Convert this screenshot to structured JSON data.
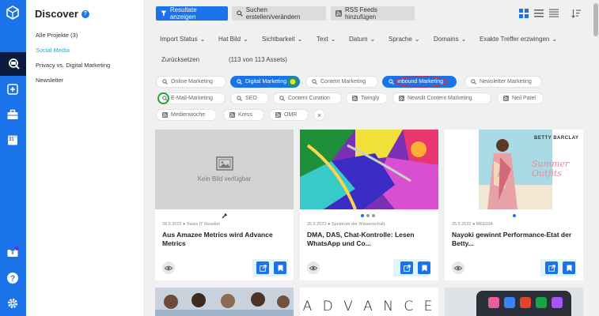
{
  "rail": {
    "icons": [
      "logo-cube-icon",
      "discover-icon",
      "add-icon",
      "briefcase-icon",
      "calendar-icon",
      "upload-icon",
      "help-icon",
      "settings-icon"
    ],
    "calendar_day": "31"
  },
  "sidebar": {
    "title": "Discover",
    "help_label": "?",
    "items": [
      {
        "label": "Alle Projekte (3)"
      },
      {
        "label": "Social Media"
      },
      {
        "label": "Privacy vs. Digital Marketing"
      },
      {
        "label": "Newsletter"
      }
    ]
  },
  "toolbar": {
    "show_results": "Resultate anzeigen",
    "search_create": "Suchen erstellen/verändern",
    "rss_add": "RSS Feeds hinzufügen"
  },
  "filters": {
    "items": [
      "Import Status",
      "Hat Bild",
      "Sichtbarkeit",
      "Text",
      "Datum",
      "Sprache",
      "Domains",
      "Exakte Treffer erzwingen"
    ],
    "reset": "Zurücksetzen",
    "count": "(113 von 113 Assets)"
  },
  "chips": [
    {
      "label": "Online Marketing",
      "icon": "search",
      "active": false
    },
    {
      "label": "Digital Marketing",
      "icon": "search",
      "active": true
    },
    {
      "label": "Content Marketing",
      "icon": "search",
      "active": false
    },
    {
      "label": "Inbound Marketing",
      "icon": "search",
      "active": true
    },
    {
      "label": "Newsletter Marketing",
      "icon": "search",
      "active": false
    },
    {
      "label": "E-Mail-Marketing",
      "icon": "search",
      "active": false
    },
    {
      "label": "SEO",
      "icon": "search",
      "active": false
    },
    {
      "label": "Content Curation",
      "icon": "search",
      "active": false
    },
    {
      "label": "Twingly",
      "icon": "rss",
      "active": false
    },
    {
      "label": "Newslit Content Marketing",
      "icon": "rss",
      "active": false
    },
    {
      "label": "Neil Patel",
      "icon": "rss",
      "active": false
    },
    {
      "label": "Medienwoche",
      "icon": "rss",
      "active": false
    },
    {
      "label": "Kress",
      "icon": "rss",
      "active": false
    },
    {
      "label": "OMR",
      "icon": "rss",
      "active": false
    }
  ],
  "chip_clear": "×",
  "cards": [
    {
      "image": "placeholder",
      "placeholder_text": "Kein Bild verfügbar",
      "meta": "28.5.2022 ● Swiss IT Reseller",
      "title": "Aus Amazee Metrics wird Advance Metrics"
    },
    {
      "image": "abstract-colorful",
      "meta": "25.5.2022 ● Spektrum der Wissenschaft",
      "title": "DMA, DAS, Chat-Kontrolle: Lesen WhatsApp und Co..."
    },
    {
      "image": "fashion-model",
      "image_brand": "BETTY BARCLAY",
      "image_script": "Summer Outfits",
      "meta": "25.5.2022 ● MEEDIA",
      "title": "Nayoki gewinnt Performance-Etat der Betty..."
    }
  ],
  "row2": {
    "advance_text": "A D V A N C E"
  },
  "colors": {
    "primary": "#1a73e8",
    "rail": "#1a73e8",
    "active_nav": "#0a1c3d",
    "link_active": "#28a9d6",
    "annotation_green": "#22a33a",
    "annotation_red": "#e0282e"
  }
}
